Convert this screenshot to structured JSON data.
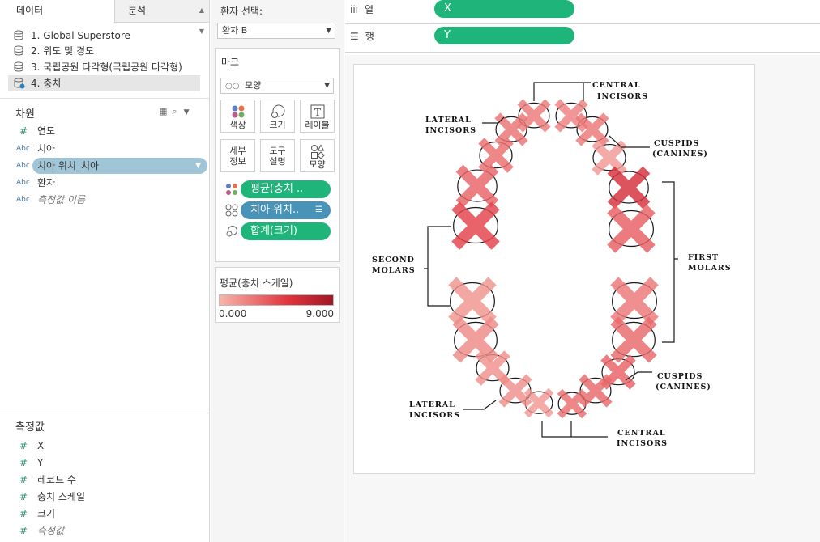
{
  "left_pane": {
    "tabs": {
      "data": "데이터",
      "analysis": "분석"
    },
    "datasources": [
      {
        "label": "1. Global Superstore"
      },
      {
        "label": "2. 위도 및 경도"
      },
      {
        "label": "3. 국립공원 다각형(국립공원 다각형)"
      },
      {
        "label": "4. 충치",
        "selected": true
      }
    ],
    "dimensions_title": "차원",
    "dimensions": [
      {
        "type": "#",
        "label": "연도"
      },
      {
        "type": "Abc",
        "label": "치아"
      },
      {
        "type": "Abc",
        "label": "치아 위치_치아",
        "selected": true
      },
      {
        "type": "Abc",
        "label": "환자"
      },
      {
        "type": "Abc",
        "label": "측정값 이름",
        "italic": true
      }
    ],
    "measures_title": "측정값",
    "measures": [
      {
        "type": "#",
        "label": "X"
      },
      {
        "type": "#",
        "label": "Y"
      },
      {
        "type": "#",
        "label": "레코드 수"
      },
      {
        "type": "#",
        "label": "충치 스케일"
      },
      {
        "type": "#",
        "label": "크기"
      },
      {
        "type": "#",
        "label": "측정값",
        "italic": true
      }
    ]
  },
  "middle_pane": {
    "patient_filter": {
      "label": "환자 선택:",
      "value": "환자 B"
    },
    "marks_title": "마크",
    "mark_type": "모양",
    "mark_buttons": {
      "color": "색상",
      "size": "크기",
      "label": "레이블",
      "detail_1": "세부",
      "detail_2": "정보",
      "tooltip_1": "도구",
      "tooltip_2": "설명",
      "shape": "모양"
    },
    "mark_pills": {
      "color": "평균(충치 ..",
      "shape": "치아 위치..",
      "size": "합계(크기)"
    },
    "legend": {
      "title": "평균(충치 스케일)",
      "min": "0.000",
      "max": "9.000",
      "color_low": "#f7b5ac",
      "color_high": "#a01725"
    }
  },
  "shelves": {
    "columns": {
      "label": "열",
      "pill": "X"
    },
    "rows": {
      "label": "행",
      "pill": "Y"
    }
  },
  "viz": {
    "annotations": {
      "central_top_1": "CENTRAL",
      "central_top_2": "INCISORS",
      "lateral_top_1": "LATERAL",
      "lateral_top_2": "INCISORS",
      "cuspids_top_1": "CUSPIDS",
      "cuspids_top_2": "(CANINES)",
      "second_molars_1": "SECOND",
      "second_molars_2": "MOLARS",
      "first_molars_1": "FIRST",
      "first_molars_2": "MOLARS",
      "cuspids_bot_1": "CUSPIDS",
      "cuspids_bot_2": "(CANINES)",
      "lateral_bot_1": "LATERAL",
      "lateral_bot_2": "INCISORS",
      "central_bot_1": "CENTRAL",
      "central_bot_2": "INCISORS"
    },
    "teeth": [
      {
        "name": "upper-central-left",
        "scale": 2.5
      },
      {
        "name": "upper-central-right",
        "scale": 2.2
      },
      {
        "name": "upper-lateral-left",
        "scale": 2.8
      },
      {
        "name": "upper-lateral-right",
        "scale": 2.6
      },
      {
        "name": "upper-cuspid-left",
        "scale": 3.0
      },
      {
        "name": "upper-cuspid-right",
        "scale": 1.2
      },
      {
        "name": "upper-premolar-left",
        "scale": 3.4
      },
      {
        "name": "upper-premolar-right",
        "scale": 6.0
      },
      {
        "name": "upper-molar-left",
        "scale": 4.8
      },
      {
        "name": "upper-molar-right",
        "scale": 3.6
      },
      {
        "name": "lower-molar-left",
        "scale": 1.4
      },
      {
        "name": "lower-molar-right",
        "scale": 2.6
      },
      {
        "name": "lower-molar2-left",
        "scale": 1.8
      },
      {
        "name": "lower-molar2-right",
        "scale": 3.2
      },
      {
        "name": "lower-cuspid-left",
        "scale": 1.5
      },
      {
        "name": "lower-cuspid-right",
        "scale": 3.5
      },
      {
        "name": "lower-lateral-left",
        "scale": 1.6
      },
      {
        "name": "lower-lateral-right",
        "scale": 3.2
      },
      {
        "name": "lower-incisor-left",
        "scale": 1.2
      },
      {
        "name": "lower-incisor-right",
        "scale": 3.0
      },
      {
        "name": "lower-central-left",
        "scale": 1.0
      },
      {
        "name": "lower-central-right",
        "scale": 2.8
      }
    ]
  }
}
